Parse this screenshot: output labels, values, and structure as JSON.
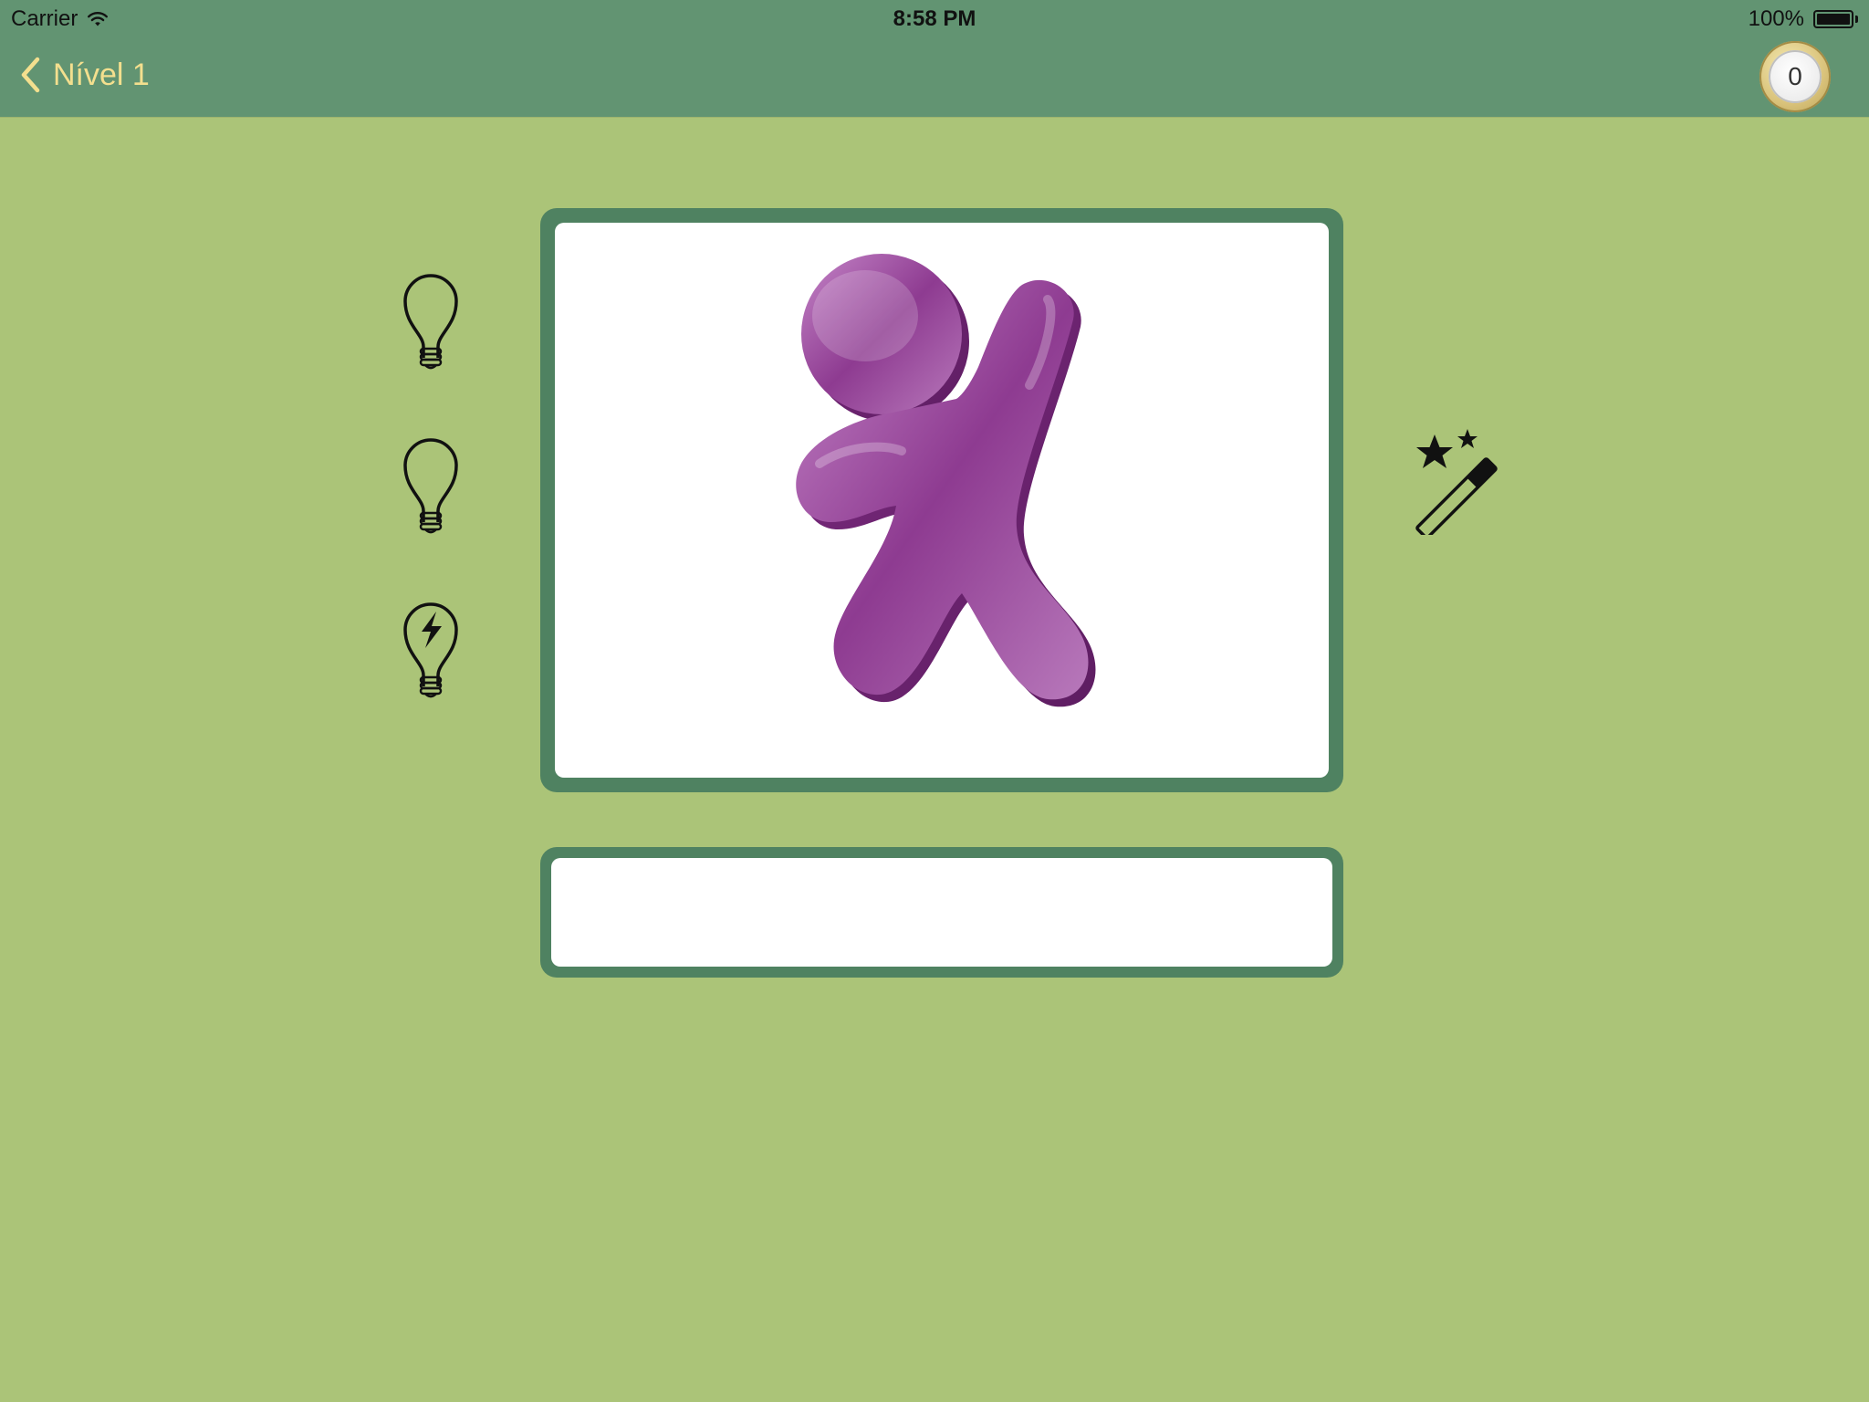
{
  "status_bar": {
    "carrier": "Carrier",
    "time": "8:58 PM",
    "battery_percent": "100%",
    "battery_level": 1.0
  },
  "nav": {
    "back_label": "Nível 1",
    "back_icon": "chevron-left-icon",
    "coins": "0"
  },
  "hints": [
    {
      "icon": "lightbulb-icon"
    },
    {
      "icon": "lightbulb-icon"
    },
    {
      "icon": "lightbulb-bolt-icon"
    }
  ],
  "image": {
    "subject": "purple-figure-logo-icon"
  },
  "magic": {
    "icon": "magic-wand-icon"
  },
  "answer": {
    "value": "",
    "placeholder": ""
  },
  "colors": {
    "background": "#abc478",
    "header": "#629472",
    "frame": "#4f8261",
    "nav_text": "#f3df8e",
    "figure": "#8e3b91"
  }
}
